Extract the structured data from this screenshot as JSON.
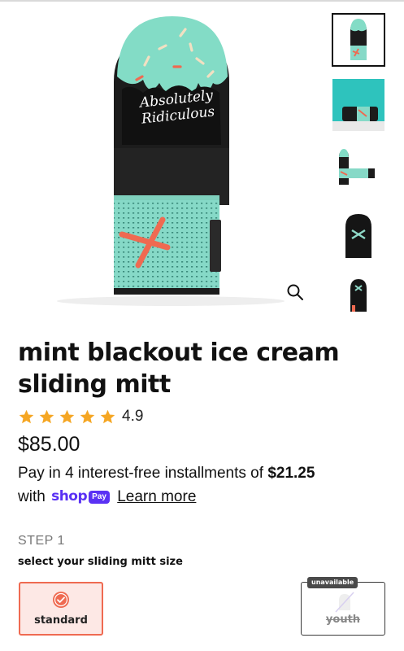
{
  "product": {
    "title": "mint blackout ice cream sliding mitt",
    "rating": "4.9",
    "rating_stars": 5,
    "price": "$85.00",
    "mitt_text_line1": "Absolutely",
    "mitt_text_line2": "Ridiculous"
  },
  "installments": {
    "prefix": "Pay in 4 interest-free installments of ",
    "amount": "$21.25",
    "with": "with",
    "shop_word": "shop",
    "pay_pill": "Pay",
    "learn_more": "Learn more"
  },
  "size_select": {
    "step": "STEP 1",
    "label": "select your sliding mitt size",
    "options": [
      {
        "label": "standard",
        "selected": true
      },
      {
        "label": "youth",
        "badge": "unavailable"
      }
    ]
  },
  "icons": {
    "zoom": "magnifier-icon",
    "star": "star-icon",
    "check": "check-circle-icon"
  },
  "colors": {
    "mint": "#7ee0cc",
    "accent_orange": "#ef6a51",
    "star": "#f5a623",
    "shop_purple": "#5a31f4"
  }
}
